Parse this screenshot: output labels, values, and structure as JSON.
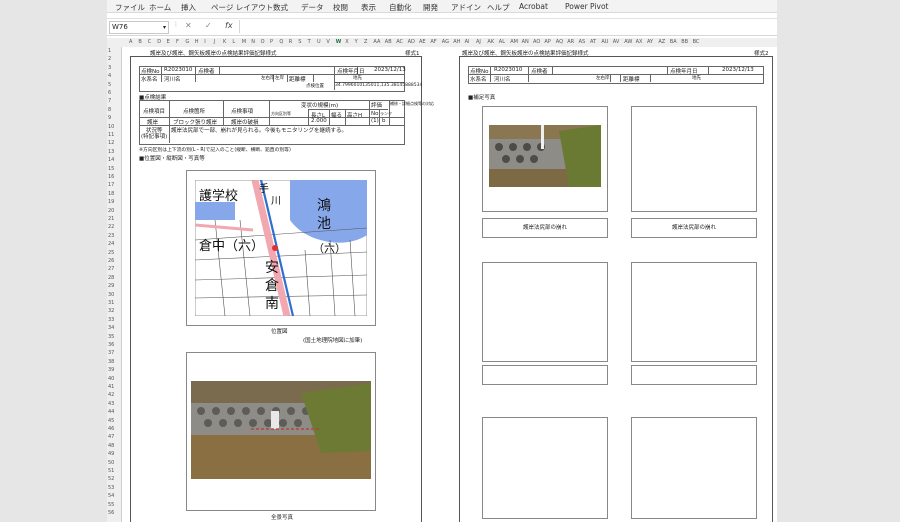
{
  "ribbon": {
    "tabs": [
      "ファイル",
      "ホーム",
      "挿入",
      "ページ レイアウト",
      "数式",
      "データ",
      "校閲",
      "表示",
      "自動化",
      "開発",
      "アドイン",
      "ヘルプ",
      "Acrobat",
      "Power Pivot"
    ]
  },
  "formula_bar": {
    "name_box": "W76",
    "fx": "fx",
    "cancel": "✕",
    "enter": "✓"
  },
  "columns": [
    "A",
    "B",
    "C",
    "D",
    "E",
    "F",
    "G",
    "H",
    "I",
    "J",
    "K",
    "L",
    "M",
    "N",
    "O",
    "P",
    "Q",
    "R",
    "S",
    "T",
    "U",
    "V",
    "W",
    "X",
    "Y",
    "Z",
    "AA",
    "AB",
    "AC",
    "AD",
    "AE",
    "AF",
    "AG",
    "AH",
    "AI",
    "AJ",
    "AK",
    "AL",
    "AM",
    "AN",
    "AO",
    "AP",
    "AQ",
    "AR",
    "AS",
    "AT",
    "AU",
    "AV",
    "AW",
    "AX",
    "AY",
    "AZ",
    "BA",
    "BB",
    "BC"
  ],
  "selected_column": "W",
  "rows": [
    "1",
    "2",
    "3",
    "4",
    "5",
    "6",
    "7",
    "8",
    "9",
    "10",
    "11",
    "12",
    "13",
    "14",
    "15",
    "16",
    "17",
    "18",
    "19",
    "20",
    "21",
    "22",
    "23",
    "24",
    "25",
    "26",
    "27",
    "28",
    "29",
    "30",
    "31",
    "32",
    "33",
    "34",
    "35",
    "36",
    "37",
    "38",
    "39",
    "40",
    "41",
    "42",
    "43",
    "44",
    "45",
    "46",
    "47",
    "48",
    "49",
    "50",
    "51",
    "52",
    "53",
    "54",
    "55",
    "56"
  ],
  "left_page": {
    "title": "護岸及び護岸、鋼矢板護岸の点検結果評価記録様式",
    "form_no": "様式1",
    "header": {
      "no_label": "点検No",
      "no_value": "R2023010",
      "inspector_label": "点検者",
      "date_label": "点検年月日",
      "date_value": "2023/12/13",
      "river_label": "水系名",
      "river_value": "河川名",
      "bank_label": "左右岸",
      "bank_left": "左岸",
      "dist_label": "距離標",
      "place_label": "地先",
      "position_label": "点検位置",
      "position_value": "34.7996010135011,135.38145888534"
    },
    "section_result": "■点検結果",
    "table_headers": [
      "点検項目",
      "点検箇所",
      "点検事項",
      "変状の規模(m)",
      "評価",
      "補修・詳細点検等の対応"
    ],
    "sub_headers": [
      "方向区別等",
      "長さL",
      "幅る",
      "高さH",
      "No",
      "ランク"
    ],
    "row": {
      "item": "護岸",
      "place": "ブロック張り護岸",
      "matter": "護岸の破損",
      "length": "2.000",
      "no": "(1)",
      "rank": "b"
    },
    "remarks_label": "状況等\n(特記事項)",
    "remarks": "護岸法尻部で一部、崩れが見られる。今後もモニタリングを継続する。",
    "note": "※方向区別は上下流の別(L・R)で記入のこと(縦断、横断、鉛直の別等)",
    "section_map": "■位置図・縦断図・写真等",
    "map_caption": "位置図",
    "map_source": "(国土地理院地図に加筆)",
    "map_labels": [
      "護学校",
      "鴻",
      "池",
      "倉中（六）",
      "安",
      "倉",
      "南",
      "（六）",
      "手",
      "川"
    ],
    "photo_caption": "全景写真"
  },
  "right_page": {
    "title": "護岸及び護岸、鋼矢板護岸の点検結果評価記録様式",
    "form_no": "様式2",
    "no_label": "点検No",
    "no_value": "R2023010",
    "inspector_label": "点検者",
    "date_label": "点検年月日",
    "date_value": "2023/12/13",
    "river_label": "水系名",
    "river_value": "河川名",
    "bank_label": "左右岸",
    "dist_label": "距離標",
    "place_label": "地先",
    "section": "■補足写真",
    "captions": [
      "護岸法尻部の崩れ",
      "護岸法尻部の崩れ"
    ]
  },
  "colors": {
    "accent": "#1e7145",
    "road": "#f2a8b0",
    "water": "#86a8ea",
    "map_bg": "#ffffff"
  }
}
